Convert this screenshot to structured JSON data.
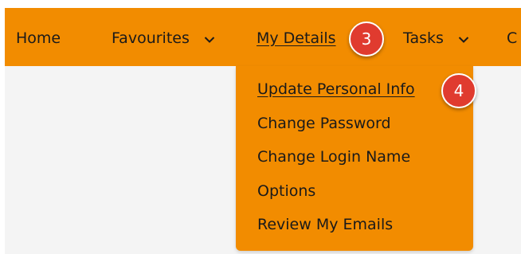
{
  "nav": {
    "items": [
      {
        "label": "Home"
      },
      {
        "label": "Favourites"
      },
      {
        "label": "My Details"
      },
      {
        "label": "Tasks"
      },
      {
        "label": "C"
      }
    ]
  },
  "dropdown": {
    "items": [
      {
        "label": "Update Personal Info"
      },
      {
        "label": "Change Password"
      },
      {
        "label": "Change Login Name"
      },
      {
        "label": "Options"
      },
      {
        "label": "Review My Emails"
      }
    ]
  },
  "badges": [
    {
      "label": "3"
    },
    {
      "label": "4"
    }
  ],
  "colors": {
    "nav_background": "#f28c00",
    "badge": "#e03b2f",
    "page_background": "#f4f4f4"
  }
}
